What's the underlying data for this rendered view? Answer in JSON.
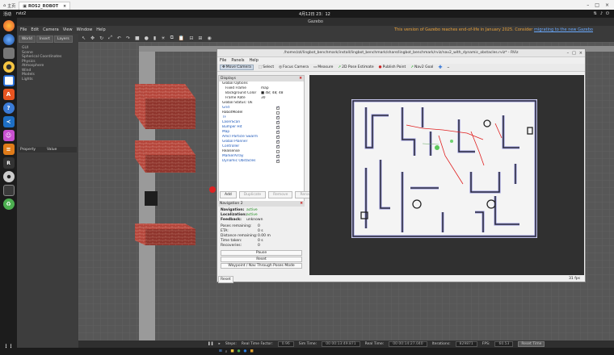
{
  "vnc": {
    "home_tab": "主页",
    "active_tab": "ROS2_ROBOT"
  },
  "top_panel": {
    "left": "活动",
    "app": "rviz2",
    "clock": "4月12日 23：12"
  },
  "dock": [
    "firefox",
    "thunderbird",
    "files",
    "rhythmbox",
    "writer",
    "software",
    "help",
    "vscode",
    "cheese",
    "layers",
    "rviz",
    "disk",
    "trash",
    "apps"
  ],
  "gazebo": {
    "title": "Gazebo",
    "menu": [
      "File",
      "Edit",
      "Camera",
      "View",
      "Window",
      "Help"
    ],
    "notice_prefix": "This version of Gazebo reaches end-of-life in January 2025. Consider",
    "notice_link": "migrating to the new Gazebo",
    "left_tabs": [
      "World",
      "Insert",
      "Layers"
    ],
    "tree": [
      "GUI",
      "Scene",
      "Spherical Coordinates",
      "Physics",
      "Atmosphere",
      "Wind",
      "Models",
      "Lights"
    ],
    "prop_header": [
      "Property",
      "Value"
    ],
    "bottom": {
      "steps": "Steps:",
      "rtf_label": "Real Time Factor:",
      "rtf": "0.96",
      "sim_label": "Sim Time:",
      "sim": "00 00:13:49.871",
      "real_label": "Real Time:",
      "real": "00 00:14:27.040",
      "iter_label": "Iterations:",
      "iter": "829871",
      "fps_label": "FPS:",
      "fps": "60.53",
      "reset": "Reset Time"
    }
  },
  "rviz": {
    "title": "/home/zzl/lingbot_benchmark/install/lingbot_benchmark/share/lingbot_benchmark/rviz/nav2_with_dynamic_obstacles.rviz* - RViz",
    "menu": [
      "File",
      "Panels",
      "Help"
    ],
    "tools": [
      "Move Camera",
      "Select",
      "Focus Camera",
      "Measure",
      "2D Pose Estimate",
      "Publish Point",
      "Nav2 Goal"
    ],
    "displays_header": "Displays",
    "rows": [
      {
        "n": "Global Options",
        "v": "",
        "cb": "",
        "blue": false,
        "ind": 1
      },
      {
        "n": "Fixed Frame",
        "v": "map",
        "cb": "",
        "blue": false,
        "ind": 2
      },
      {
        "n": "Background Color",
        "v": "■ 48; 48; 48",
        "cb": "",
        "blue": false,
        "ind": 2
      },
      {
        "n": "Frame Rate",
        "v": "30",
        "cb": "",
        "blue": false,
        "ind": 2
      },
      {
        "n": "Global Status: Ok",
        "v": "",
        "cb": "",
        "blue": false,
        "ind": 1
      },
      {
        "n": "Grid",
        "v": "",
        "cb": "on",
        "blue": true,
        "ind": 1
      },
      {
        "n": "RobotModel",
        "v": "",
        "cb": "off",
        "blue": false,
        "ind": 1
      },
      {
        "n": "TF",
        "v": "",
        "cb": "on",
        "blue": true,
        "ind": 1
      },
      {
        "n": "LaserScan",
        "v": "",
        "cb": "on",
        "blue": true,
        "ind": 1
      },
      {
        "n": "Bumper Hit",
        "v": "",
        "cb": "on",
        "blue": true,
        "ind": 1
      },
      {
        "n": "Map",
        "v": "",
        "cb": "on",
        "blue": true,
        "ind": 1
      },
      {
        "n": "Amcl Particle Swarm",
        "v": "",
        "cb": "on",
        "blue": true,
        "ind": 1
      },
      {
        "n": "Global Planner",
        "v": "",
        "cb": "on",
        "blue": true,
        "ind": 1
      },
      {
        "n": "Controller",
        "v": "",
        "cb": "on",
        "blue": true,
        "ind": 1
      },
      {
        "n": "Realsense",
        "v": "",
        "cb": "off",
        "blue": false,
        "ind": 1
      },
      {
        "n": "MarkerArray",
        "v": "",
        "cb": "on",
        "blue": true,
        "ind": 1
      },
      {
        "n": "Dynamic Obstacles",
        "v": "",
        "cb": "on",
        "blue": true,
        "ind": 1
      }
    ],
    "disp_buttons": [
      "Add",
      "Duplicate",
      "Remove",
      "Rename"
    ],
    "nav_header": "Navigation 2",
    "navigation_label": "Navigation:",
    "navigation": "active",
    "localization_label": "Localization:",
    "localization": "active",
    "feedback_label": "Feedback:",
    "feedback": "unknown",
    "stats": [
      {
        "k": "Poses remaining:",
        "v": "0"
      },
      {
        "k": "ETA:",
        "v": "0 s"
      },
      {
        "k": "Distance remaining:",
        "v": "0.00 m"
      },
      {
        "k": "Time taken:",
        "v": "0 s"
      },
      {
        "k": "Recoveries:",
        "v": "0"
      }
    ],
    "pause": "Pause",
    "reset_btn": "Reset",
    "waypoint": "Waypoint / Nav Through Poses Mode",
    "reset": "Reset",
    "fps": "31 fps"
  }
}
